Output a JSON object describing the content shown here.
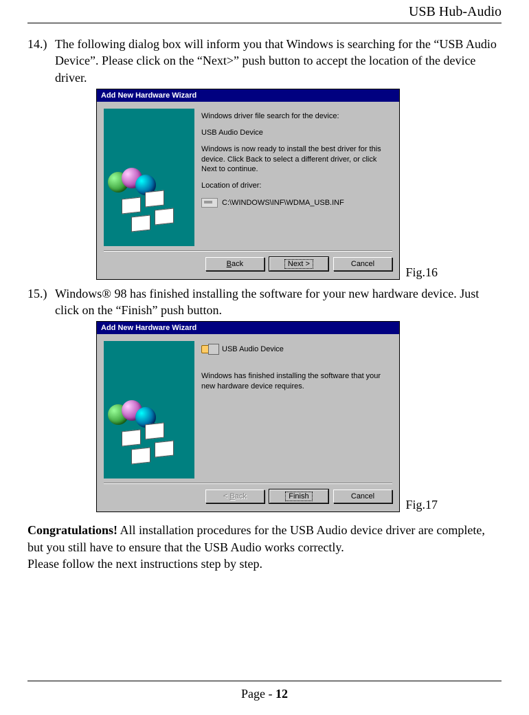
{
  "header": {
    "title": "USB Hub-Audio"
  },
  "steps": {
    "s14": {
      "num": "14.)",
      "text": "The following dialog box will inform you that Windows is searching for the “USB Audio Device”. Please click on the “Next>” push button to accept the location of the device driver."
    },
    "s15": {
      "num": "15.)",
      "text": "Windows® 98 has finished installing the software for your new hardware device. Just click on the “Finish” push button."
    }
  },
  "dialog1": {
    "title": "Add New Hardware Wizard",
    "line1": "Windows driver file search for the device:",
    "device": "USB Audio Device",
    "line2": "Windows is now ready to install the best driver for this device. Click Back to select a different driver, or click Next to continue.",
    "locLabel": "Location of driver:",
    "path": "C:\\WINDOWS\\INF\\WDMA_USB.INF",
    "buttons": {
      "back": "< Back",
      "next": "Next >",
      "cancel": "Cancel"
    },
    "figcap": "Fig.16"
  },
  "dialog2": {
    "title": "Add New Hardware Wizard",
    "device": "USB Audio Device",
    "line1": "Windows has finished installing the software that your new hardware device requires.",
    "buttons": {
      "back": "< Back",
      "finish": "Finish",
      "cancel": "Cancel"
    },
    "figcap": "Fig.17"
  },
  "congrats": {
    "lead": "Congratulations!",
    "rest": " All installation procedures for the USB Audio device driver are complete, but you still have to ensure that the USB Audio works correctly.",
    "follow": "Please follow the next instructions step by step."
  },
  "footer": {
    "prefix": "Page - ",
    "num": "12"
  }
}
